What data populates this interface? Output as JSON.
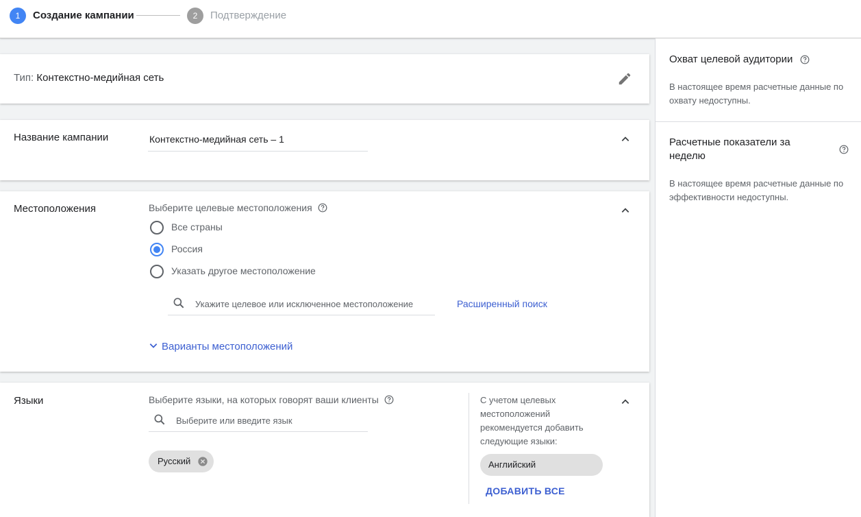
{
  "stepper": {
    "step1_number": "1",
    "step1_label": "Создание кампании",
    "step2_number": "2",
    "step2_label": "Подтверждение"
  },
  "type_card": {
    "prefix": "Тип:",
    "value": "Контекстно-медийная сеть"
  },
  "name_card": {
    "title": "Название кампании",
    "value": "Контекстно-медийная сеть – 1"
  },
  "locations_card": {
    "title": "Местоположения",
    "hint": "Выберите целевые местоположения",
    "options": [
      {
        "label": "Все страны",
        "checked": false
      },
      {
        "label": "Россия",
        "checked": true
      },
      {
        "label": "Указать другое местоположение",
        "checked": false
      }
    ],
    "search_placeholder": "Укажите целевое или исключенное местоположение",
    "advanced_search": "Расширенный поиск",
    "location_options": "Варианты местоположений"
  },
  "languages_card": {
    "title": "Языки",
    "hint": "Выберите языки, на которых говорят ваши клиенты",
    "search_placeholder": "Выберите или введите язык",
    "selected_chip": "Русский",
    "recommendation": "С учетом целевых местоположений рекомендуется добавить следующие языки:",
    "recommended_chip": "Английский",
    "add_all": "ДОБАВИТЬ ВСЕ"
  },
  "right_panel": {
    "reach_title": "Охват целевой аудитории",
    "reach_text": "В настоящее время расчетные данные по охвату недоступны.",
    "weekly_title": "Расчетные показатели за неделю",
    "weekly_text": "В настоящее время расчетные данные по эффективности недоступны."
  },
  "colors": {
    "accent": "#4285f4",
    "link": "#3c5fd1",
    "muted": "#5f6368",
    "inactive_step": "#9e9e9e"
  },
  "icons": [
    "edit-icon",
    "chevron-up-icon",
    "help-icon",
    "search-icon",
    "chevron-down-icon",
    "close-icon"
  ]
}
